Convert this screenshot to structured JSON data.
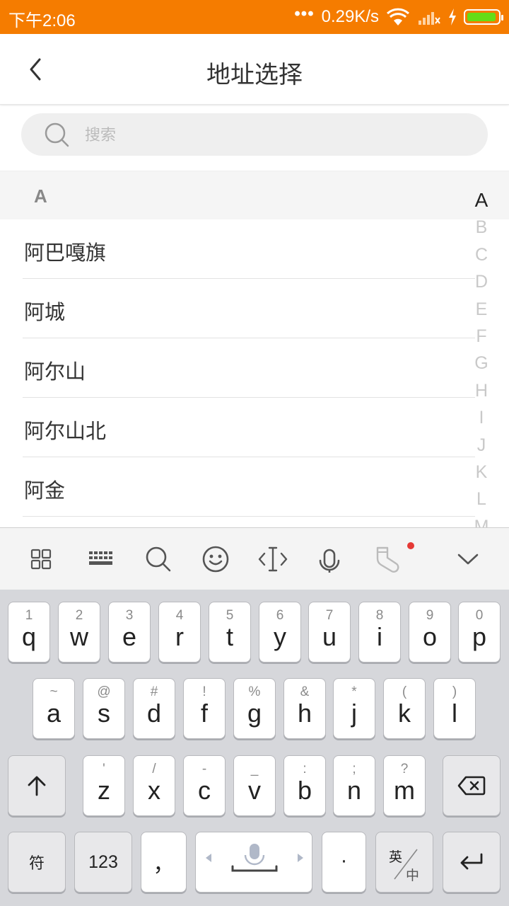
{
  "status": {
    "time": "下午2:06",
    "dots": "•••",
    "speed": "0.29K/s"
  },
  "header": {
    "title": "地址选择"
  },
  "search": {
    "placeholder": "搜索"
  },
  "section": {
    "letter": "A"
  },
  "cities": [
    "阿巴嘎旗",
    "阿城",
    "阿尔山",
    "阿尔山北",
    "阿金"
  ],
  "index_letters": [
    "A",
    "B",
    "C",
    "D",
    "E",
    "F",
    "G",
    "H",
    "I",
    "J",
    "K",
    "L",
    "M"
  ],
  "active_index": "A",
  "keyboard": {
    "row1": [
      {
        "hint": "1",
        "key": "q"
      },
      {
        "hint": "2",
        "key": "w"
      },
      {
        "hint": "3",
        "key": "e"
      },
      {
        "hint": "4",
        "key": "r"
      },
      {
        "hint": "5",
        "key": "t"
      },
      {
        "hint": "6",
        "key": "y"
      },
      {
        "hint": "7",
        "key": "u"
      },
      {
        "hint": "8",
        "key": "i"
      },
      {
        "hint": "9",
        "key": "o"
      },
      {
        "hint": "0",
        "key": "p"
      }
    ],
    "row2": [
      {
        "hint": "~",
        "key": "a"
      },
      {
        "hint": "@",
        "key": "s"
      },
      {
        "hint": "#",
        "key": "d"
      },
      {
        "hint": "!",
        "key": "f"
      },
      {
        "hint": "%",
        "key": "g"
      },
      {
        "hint": "&",
        "key": "h"
      },
      {
        "hint": "*",
        "key": "j"
      },
      {
        "hint": "(",
        "key": "k"
      },
      {
        "hint": ")",
        "key": "l"
      }
    ],
    "row3": [
      {
        "hint": "'",
        "key": "z"
      },
      {
        "hint": "/",
        "key": "x"
      },
      {
        "hint": "-",
        "key": "c"
      },
      {
        "hint": "_",
        "key": "v"
      },
      {
        "hint": ":",
        "key": "b"
      },
      {
        "hint": ";",
        "key": "n"
      },
      {
        "hint": "?",
        "key": "m"
      }
    ],
    "symbol_label": "符",
    "num_label": "123",
    "comma_label": "，",
    "period_label": "·",
    "lang_top": "英",
    "lang_bottom": "中"
  }
}
